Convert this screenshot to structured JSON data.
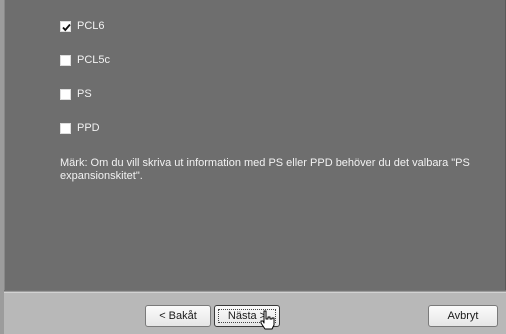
{
  "options": [
    {
      "label": "PCL6",
      "checked": true
    },
    {
      "label": "PCL5c",
      "checked": false
    },
    {
      "label": "PS",
      "checked": false
    },
    {
      "label": "PPD",
      "checked": false
    }
  ],
  "note": "Märk: Om du vill skriva ut information med PS eller PPD behöver du det valbara \"PS expansionskitet\".",
  "buttons": {
    "back_label": "< Bakåt",
    "next_label": "Nästa >",
    "cancel_label": "Avbryt"
  },
  "colors": {
    "panel_background": "#6e6e6e",
    "footer_background": "#b8b8b8",
    "text": "#f2f2f2"
  },
  "icons": {
    "pointer": "hand-pointer-icon",
    "check": "checkmark-icon"
  }
}
